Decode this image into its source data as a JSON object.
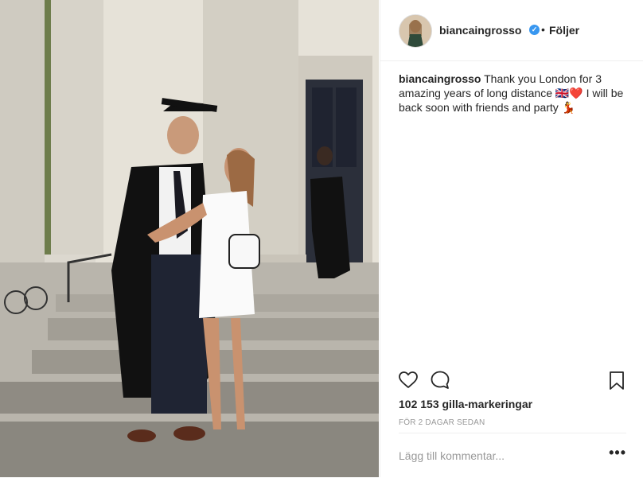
{
  "post": {
    "username": "biancaingrosso",
    "verified": true,
    "separator": "•",
    "follow_label": "Följer",
    "caption_text": "Thank you London for 3 amazing years of long distance 🇬🇧❤️ I will be back soon with friends and party 💃",
    "likes_text": "102 153 gilla-markeringar",
    "time_text": "FÖR 2 DAGAR SEDAN",
    "comment_placeholder": "Lägg till kommentar...",
    "more_label": "•••"
  },
  "icons": {
    "verified": "verified-badge-icon",
    "like": "heart-outline-icon",
    "comment": "speech-bubble-icon",
    "save": "bookmark-outline-icon",
    "more": "ellipsis-icon"
  },
  "colors": {
    "link_blue": "#3897f0",
    "text": "#262626",
    "muted": "#999999",
    "divider": "#efefef"
  }
}
